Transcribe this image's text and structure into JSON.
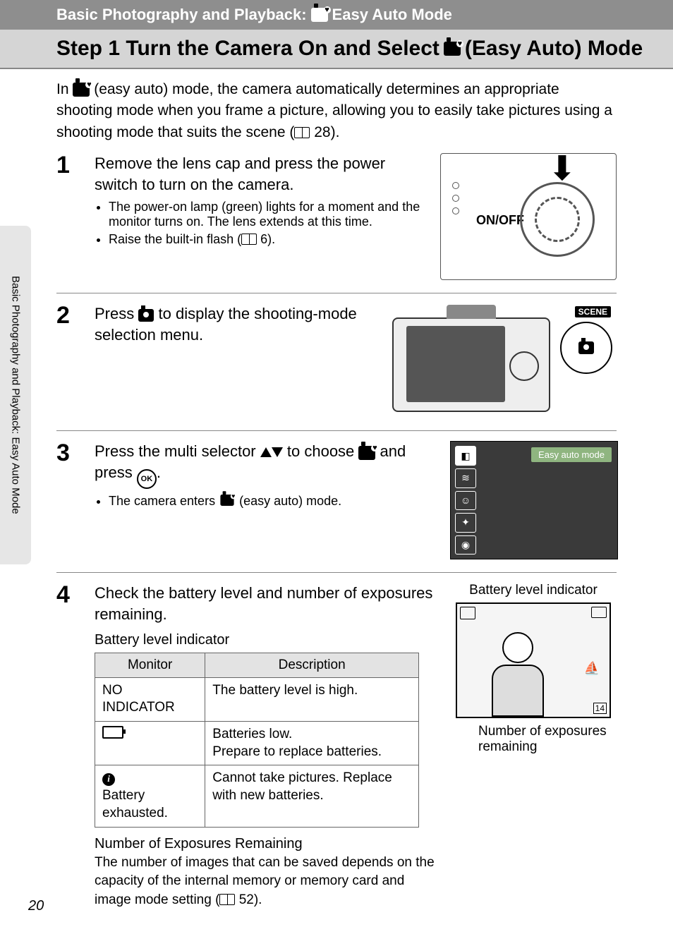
{
  "header": {
    "prefix": "Basic Photography and Playback:",
    "suffix": "Easy Auto Mode"
  },
  "title": {
    "part1": "Step 1 Turn the Camera On and Select",
    "part2": "(Easy Auto) Mode"
  },
  "intro": {
    "part1": "In",
    "part2": "(easy auto) mode, the camera automatically determines an appropriate shooting mode when you frame a picture, allowing you to easily take pictures using a shooting mode that suits the scene (",
    "ref": "28",
    "part3": ")."
  },
  "sidetab": "Basic Photography and Playback:    Easy Auto Mode",
  "steps": {
    "s1": {
      "num": "1",
      "head": "Remove the lens cap and press the power switch to turn on the camera.",
      "b1": "The power-on lamp (green) lights for a moment and the monitor turns on. The lens extends at this time.",
      "b2a": "Raise the built-in flash (",
      "b2ref": "6",
      "b2b": ").",
      "onoff": "ON/OFF"
    },
    "s2": {
      "num": "2",
      "head1": "Press",
      "head2": "to display the shooting-mode selection menu.",
      "scene": "SCENE"
    },
    "s3": {
      "num": "3",
      "head1": "Press the multi selector",
      "head2": "to choose",
      "head3": "and press",
      "head4": ".",
      "b1a": "The camera enters",
      "b1b": "(easy auto) mode.",
      "menulabel": "Easy auto mode"
    },
    "s4": {
      "num": "4",
      "head": "Check the battery level and number of exposures remaining.",
      "tbl_title": "Battery level indicator",
      "th1": "Monitor",
      "th2": "Description",
      "r1c1": "NO INDICATOR",
      "r1c2": "The battery level is high.",
      "r2c2": "Batteries low.\nPrepare to replace batteries.",
      "r3c1": "Battery exhausted.",
      "r3c2": "Cannot take pictures. Replace with new batteries.",
      "caption_top": "Battery level indicator",
      "caption_bot": "Number of exposures remaining",
      "screen_num": "14",
      "sub_head": "Number of Exposures Remaining",
      "sub_text_a": "The number of images that can be saved depends on the capacity of the internal memory or memory card and image mode setting (",
      "sub_ref": "52",
      "sub_text_b": ")."
    }
  },
  "pagenum": "20"
}
